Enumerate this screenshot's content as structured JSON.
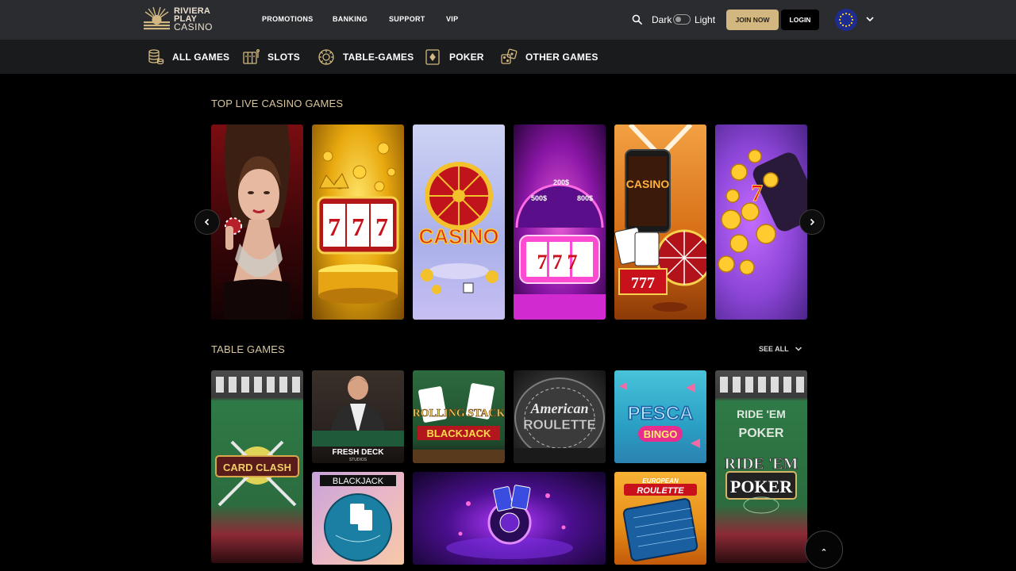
{
  "header": {
    "logo": {
      "line1": "RIVIERA",
      "line2": "PLAY",
      "line3": "CASINO"
    },
    "nav": [
      {
        "label": "PROMOTIONS"
      },
      {
        "label": "BANKING"
      },
      {
        "label": "SUPPORT"
      },
      {
        "label": "VIP"
      }
    ],
    "theme_dark_label": "Dark",
    "theme_light_label": "Light",
    "join_label": "JOIN NOW",
    "login_label": "LOGIN",
    "language_icon": "eu-flag-icon",
    "colors": {
      "accent": "#d2b880",
      "bar": "#2b2c30"
    }
  },
  "categories": [
    {
      "label": "ALL GAMES",
      "icon": "coin-stack-icon"
    },
    {
      "label": "SLOTS",
      "icon": "slot-reels-icon"
    },
    {
      "label": "TABLE-GAMES",
      "icon": "roulette-wheel-icon"
    },
    {
      "label": "POKER",
      "icon": "playing-card-icon"
    },
    {
      "label": "OTHER GAMES",
      "icon": "dice-icon"
    }
  ],
  "live_section": {
    "title": "TOP LIVE CASINO GAMES",
    "cards": [
      {
        "name": "live-dealer-woman"
      },
      {
        "name": "golden-777-slot"
      },
      {
        "name": "casino-wheel",
        "text": "CASINO"
      },
      {
        "name": "purple-777-wheel",
        "text": "777"
      },
      {
        "name": "online-casino-phone",
        "text": "CASINO"
      },
      {
        "name": "flying-coins-777",
        "text": "7"
      }
    ]
  },
  "table_section": {
    "title": "TABLE GAMES",
    "see_all": "SEE ALL",
    "cards": [
      {
        "name": "card-clash",
        "text": "CARD CLASH"
      },
      {
        "name": "fresh-deck-dealer",
        "text": "FRESH DECK",
        "sub": "STUDIOS"
      },
      {
        "name": "rolling-stack-blackjack",
        "text": "ROLLING STACK",
        "text2": "BLACKJACK"
      },
      {
        "name": "american-roulette",
        "text": "American",
        "text2": "ROULETTE"
      },
      {
        "name": "pesca-bingo",
        "text": "PESCA",
        "text2": "BINGO"
      },
      {
        "name": "ride-em-poker",
        "text": "RIDE 'EM",
        "text2": "POKER"
      },
      {
        "name": "blackjack-tile",
        "text": "BLACKJACK"
      },
      {
        "name": "purple-roulette-cards"
      },
      {
        "name": "european-roulette",
        "text": "EUROPEAN",
        "text2": "ROULETTE"
      }
    ]
  }
}
